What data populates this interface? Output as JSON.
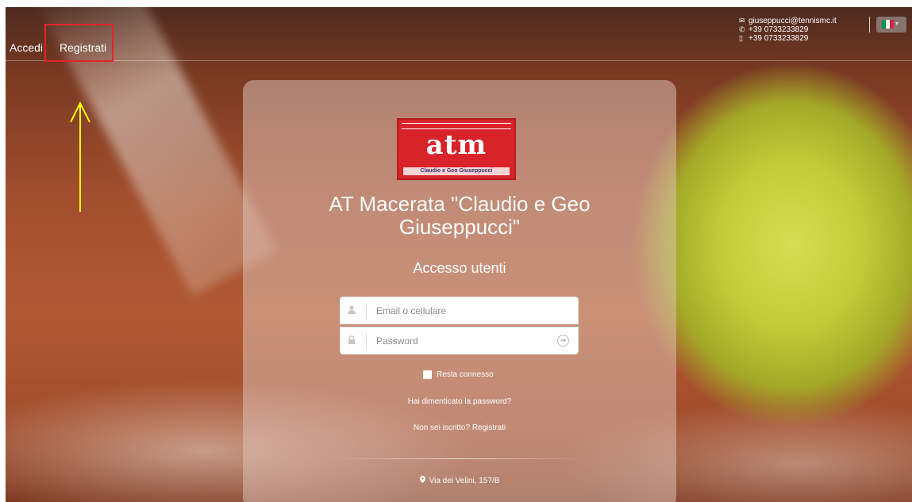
{
  "nav": {
    "login_label": "Accedi",
    "register_label": "Registrati"
  },
  "contact": {
    "email": "giuseppucci@tennismc.it",
    "phone": "+39 0733233829",
    "mobile": "+39 0733233829"
  },
  "language": {
    "selected": "Italiano"
  },
  "card": {
    "logo_mark": "atm",
    "logo_subtitle": "Claudio e Geo Giuseppucci",
    "club_name_line1": "AT Macerata \"Claudio e Geo",
    "club_name_line2": "Giuseppucci\"",
    "login_heading": "Accesso utenti",
    "email_placeholder": "Email o cellulare",
    "password_placeholder": "Password",
    "remember_label": "Resta connesso",
    "forgot_label": "Hai dimenticato la password?",
    "register_prompt": "Non sei iscritto? Registrati",
    "address": "Via dei Velini, 157/B"
  },
  "colors": {
    "highlight": "#e2232e",
    "arrow": "#ffff00",
    "logo_red": "#d8232a"
  }
}
